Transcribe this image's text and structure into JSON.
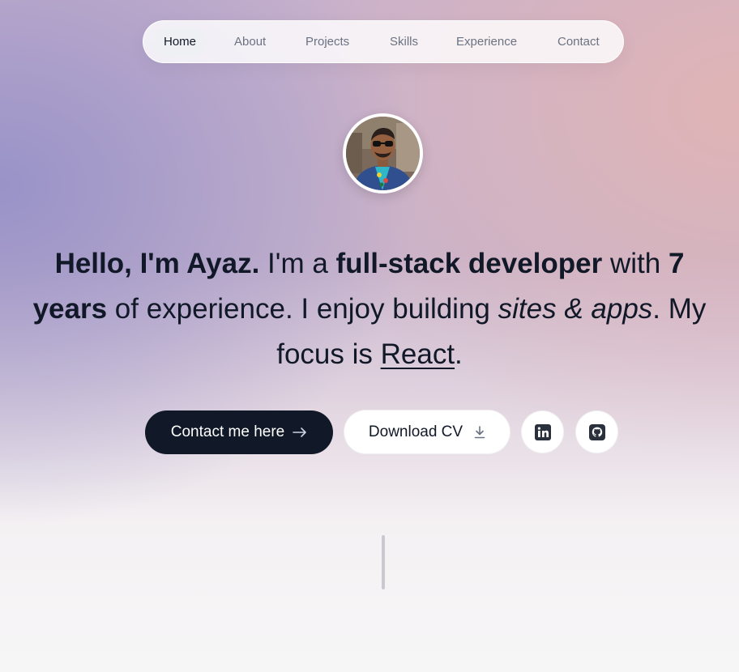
{
  "nav": {
    "items": [
      "Home",
      "About",
      "Projects",
      "Skills",
      "Experience",
      "Contact"
    ],
    "active": "Home"
  },
  "avatar": {
    "alt": "profile photo"
  },
  "hero": {
    "greeting": "Hello, I'm Ayaz.",
    "t1": " I'm a ",
    "role": "full-stack developer",
    "t2": " with ",
    "years": "7 years",
    "t3": " of experience. I enjoy building ",
    "craft": "sites & apps",
    "t4": ". My focus is ",
    "focus": "React",
    "t5": "."
  },
  "actions": {
    "contact_label": "Contact me here",
    "download_label": "Download CV"
  },
  "icons": {
    "arrow": "arrow-right-icon",
    "download": "download-icon",
    "linkedin": "linkedin-icon",
    "github": "github-icon"
  },
  "colors": {
    "primary": "#111827",
    "nav_text": "#6b7280",
    "accent_purple": "#9a96c8",
    "accent_pink": "#e1b4b4"
  }
}
